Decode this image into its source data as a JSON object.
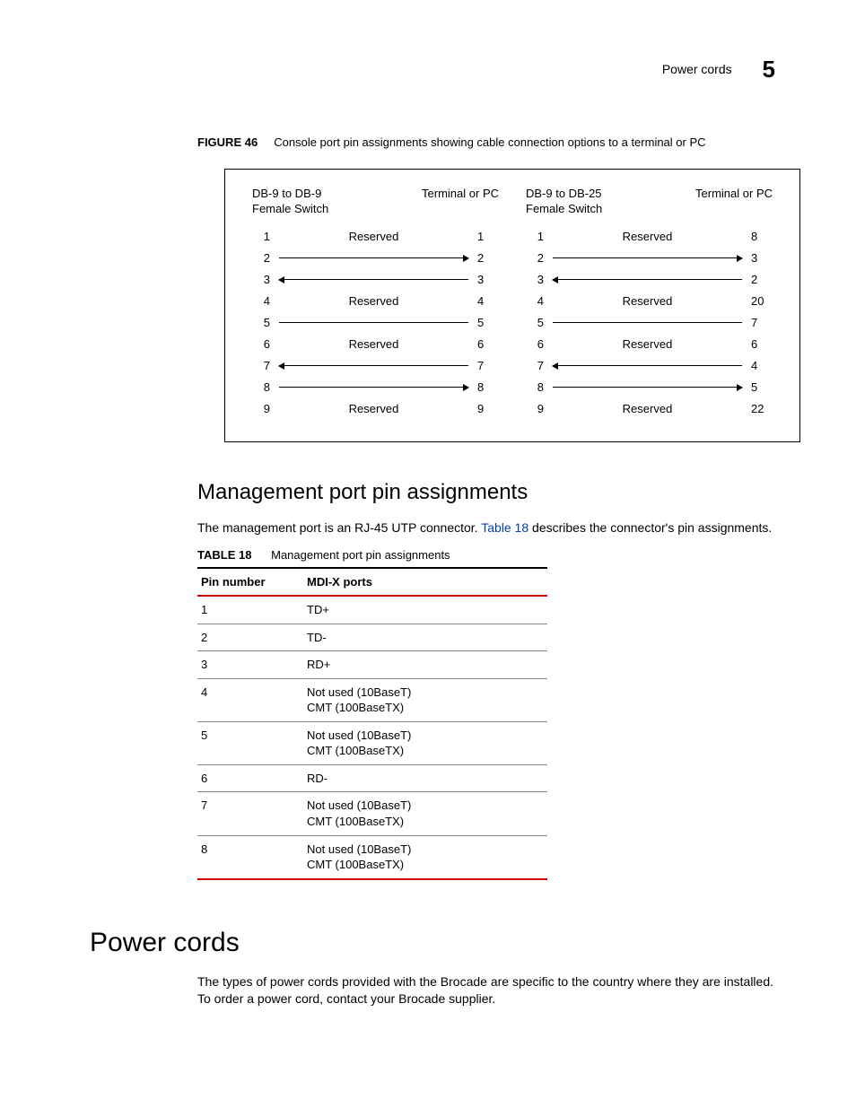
{
  "header": {
    "section": "Power cords",
    "chapter_number": "5"
  },
  "figure": {
    "label": "FIGURE 46",
    "caption": "Console port pin assignments showing cable connection options to a terminal or PC",
    "left": {
      "head_left": "DB-9 to DB-9\nFemale Switch",
      "head_right": "Terminal or PC",
      "rows": [
        {
          "l": "1",
          "type": "text",
          "mid": "Reserved",
          "r": "1"
        },
        {
          "l": "2",
          "type": "arrow",
          "dir": "r",
          "r": "2"
        },
        {
          "l": "3",
          "type": "arrow",
          "dir": "l",
          "r": "3"
        },
        {
          "l": "4",
          "type": "text",
          "mid": "Reserved",
          "r": "4"
        },
        {
          "l": "5",
          "type": "line",
          "r": "5"
        },
        {
          "l": "6",
          "type": "text",
          "mid": "Reserved",
          "r": "6"
        },
        {
          "l": "7",
          "type": "arrow",
          "dir": "l",
          "r": "7"
        },
        {
          "l": "8",
          "type": "arrow",
          "dir": "r",
          "r": "8"
        },
        {
          "l": "9",
          "type": "text",
          "mid": "Reserved",
          "r": "9"
        }
      ]
    },
    "right": {
      "head_left": "DB-9 to DB-25\nFemale Switch",
      "head_right": "Terminal or PC",
      "rows": [
        {
          "l": "1",
          "type": "text",
          "mid": "Reserved",
          "r": "8"
        },
        {
          "l": "2",
          "type": "arrow",
          "dir": "r",
          "r": "3"
        },
        {
          "l": "3",
          "type": "arrow",
          "dir": "l",
          "r": "2"
        },
        {
          "l": "4",
          "type": "text",
          "mid": "Reserved",
          "r": "20"
        },
        {
          "l": "5",
          "type": "line",
          "r": "7"
        },
        {
          "l": "6",
          "type": "text",
          "mid": "Reserved",
          "r": "6"
        },
        {
          "l": "7",
          "type": "arrow",
          "dir": "l",
          "r": "4"
        },
        {
          "l": "8",
          "type": "arrow",
          "dir": "r",
          "r": "5"
        },
        {
          "l": "9",
          "type": "text",
          "mid": "Reserved",
          "r": "22"
        }
      ]
    }
  },
  "section1": {
    "heading": "Management port pin assignments",
    "para_before": "The management port is an RJ-45 UTP connector. ",
    "link": "Table 18",
    "para_after": " describes the connector's pin assignments."
  },
  "table18": {
    "label": "TABLE 18",
    "caption": "Management port pin assignments",
    "headers": [
      "Pin number",
      "MDI-X ports"
    ],
    "rows": [
      [
        "1",
        "TD+"
      ],
      [
        "2",
        "TD-"
      ],
      [
        "3",
        "RD+"
      ],
      [
        "4",
        "Not used (10BaseT)\nCMT (100BaseTX)"
      ],
      [
        "5",
        "Not used (10BaseT)\nCMT (100BaseTX)"
      ],
      [
        "6",
        "RD-"
      ],
      [
        "7",
        "Not used (10BaseT)\nCMT (100BaseTX)"
      ],
      [
        "8",
        "Not used (10BaseT)\nCMT (100BaseTX)"
      ]
    ]
  },
  "section2": {
    "heading": "Power cords",
    "para": "The types of power cords provided with the Brocade are specific to the country where they are installed. To order a power cord, contact your Brocade supplier."
  }
}
